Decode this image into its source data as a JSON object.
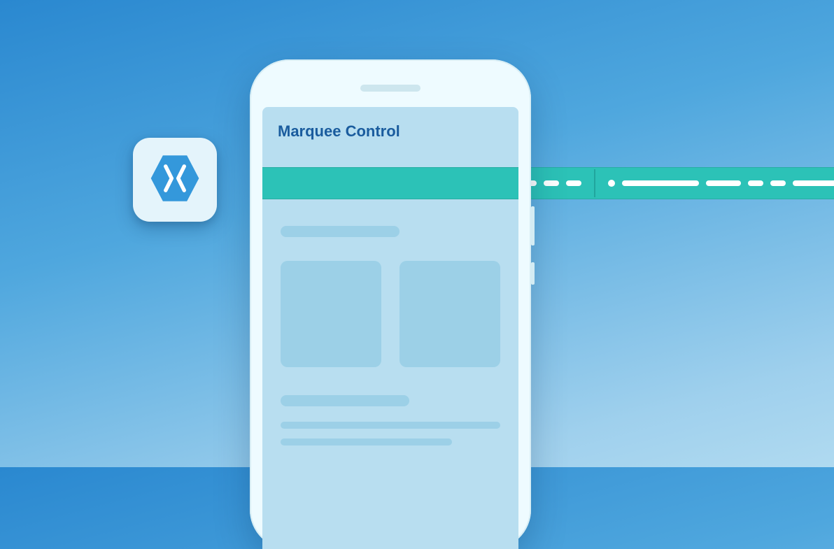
{
  "screen": {
    "title": "Marquee Control"
  },
  "badge": {
    "icon_name": "xamarin-hexagon-x",
    "bg_color": "#e4f4fb",
    "hex_color": "#3498db"
  },
  "marquee": {
    "bg_color": "#2cc2b7",
    "dash_color": "#ffffff"
  }
}
